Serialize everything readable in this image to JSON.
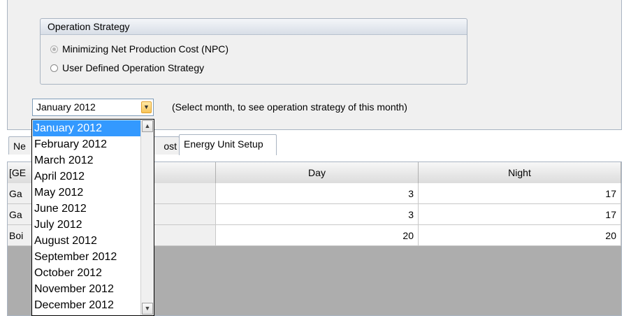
{
  "operation_strategy": {
    "title": "Operation Strategy",
    "options": [
      {
        "label": "Minimizing Net Production Cost (NPC)",
        "selected": true,
        "disabled": true
      },
      {
        "label": "User Defined Operation Strategy",
        "selected": false,
        "disabled": false
      }
    ]
  },
  "month_select": {
    "value": "January 2012",
    "hint": "(Select month, to see operation strategy of this month)",
    "options": [
      "January 2012",
      "February 2012",
      "March 2012",
      "April 2012",
      "May 2012",
      "June 2012",
      "July 2012",
      "August 2012",
      "September 2012",
      "October 2012",
      "November 2012",
      "December 2012"
    ],
    "highlighted": "January 2012"
  },
  "tabs": [
    {
      "label": "Ne"
    },
    {
      "label": "ost"
    },
    {
      "label": "Energy Unit Setup"
    }
  ],
  "grid": {
    "columns": [
      "[GE",
      "Day",
      "Night"
    ],
    "rows": [
      {
        "name": "Ga",
        "day": "3",
        "night": "17"
      },
      {
        "name": "Ga",
        "day": "3",
        "night": "17"
      },
      {
        "name": "Boi",
        "day": "20",
        "night": "20"
      }
    ]
  },
  "icons": {
    "combo_arrow": "chevron-down-icon",
    "scroll_up": "arrow-up-icon",
    "scroll_down": "arrow-down-icon"
  },
  "colors": {
    "selection": "#3399ff",
    "combo_button": "#f6c45a",
    "grid_background": "#adadad"
  }
}
